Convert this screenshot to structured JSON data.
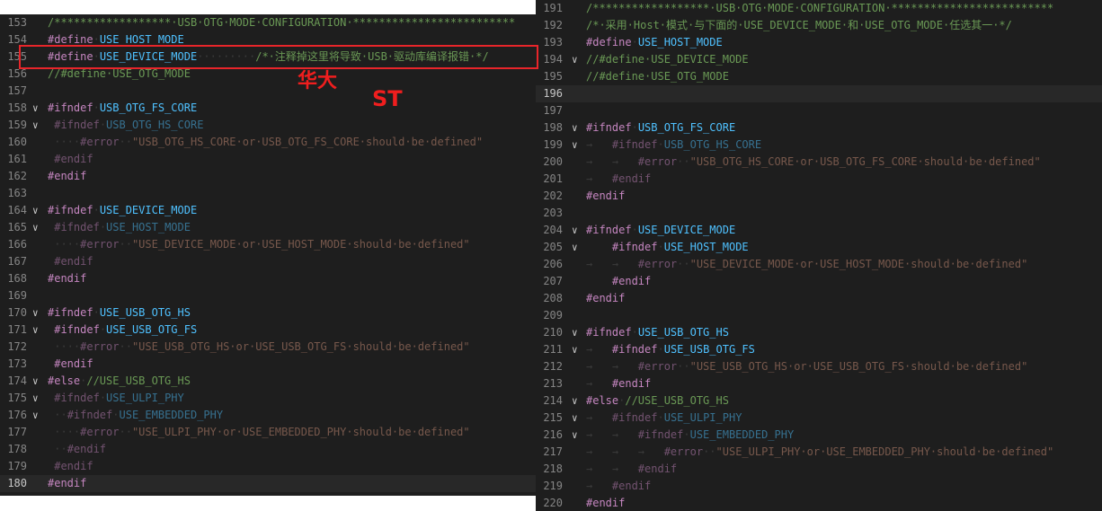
{
  "left_label": "华大",
  "right_label": "ST",
  "left": {
    "lines": [
      {
        "n": "153",
        "fold": "",
        "segs": [
          {
            "t": "/******************·USB·OTG·MODE·CONFIGURATION·*************************",
            "c": "cm"
          }
        ]
      },
      {
        "n": "154",
        "fold": "",
        "segs": [
          {
            "t": "#define",
            "c": "dir"
          },
          {
            "t": "·",
            "c": "ws"
          },
          {
            "t": "USE_HOST_MODE",
            "c": "mac"
          }
        ]
      },
      {
        "n": "155",
        "fold": "",
        "segs": [
          {
            "t": "#define",
            "c": "dir"
          },
          {
            "t": "·",
            "c": "ws"
          },
          {
            "t": "USE_DEVICE_MODE",
            "c": "mac"
          },
          {
            "t": "·········",
            "c": "ws"
          },
          {
            "t": "/*·注释掉这里将导致·USB·驱动库编译报错·*/",
            "c": "cm"
          }
        ]
      },
      {
        "n": "156",
        "fold": "",
        "segs": [
          {
            "t": "//#define·USE_OTG_MODE",
            "c": "cm"
          }
        ]
      },
      {
        "n": "157",
        "fold": "",
        "segs": []
      },
      {
        "n": "158",
        "fold": "v",
        "segs": [
          {
            "t": "#ifndef",
            "c": "dir"
          },
          {
            "t": "·",
            "c": "ws"
          },
          {
            "t": "USB_OTG_FS_CORE",
            "c": "mac"
          }
        ]
      },
      {
        "n": "159",
        "fold": "v",
        "segs": [
          {
            "t": " ",
            "c": "ws"
          },
          {
            "t": "#ifndef",
            "c": "dir dim"
          },
          {
            "t": "·",
            "c": "ws"
          },
          {
            "t": "USB_OTG_HS_CORE",
            "c": "mac dim"
          }
        ]
      },
      {
        "n": "160",
        "fold": "",
        "segs": [
          {
            "t": " ····",
            "c": "ws"
          },
          {
            "t": "#error",
            "c": "dir dim"
          },
          {
            "t": "··",
            "c": "ws"
          },
          {
            "t": "\"USB_OTG_HS_CORE·or·USB_OTG_FS_CORE·should·be·defined\"",
            "c": "str dim"
          }
        ]
      },
      {
        "n": "161",
        "fold": "",
        "segs": [
          {
            "t": " ",
            "c": "ws"
          },
          {
            "t": "#endif",
            "c": "dir dim"
          }
        ]
      },
      {
        "n": "162",
        "fold": "",
        "segs": [
          {
            "t": "#endif",
            "c": "dir"
          }
        ]
      },
      {
        "n": "163",
        "fold": "",
        "segs": []
      },
      {
        "n": "164",
        "fold": "v",
        "segs": [
          {
            "t": "#ifndef",
            "c": "dir"
          },
          {
            "t": "·",
            "c": "ws"
          },
          {
            "t": "USE_DEVICE_MODE",
            "c": "mac"
          }
        ]
      },
      {
        "n": "165",
        "fold": "v",
        "segs": [
          {
            "t": " ",
            "c": "ws"
          },
          {
            "t": "#ifndef",
            "c": "dir dim"
          },
          {
            "t": "·",
            "c": "ws"
          },
          {
            "t": "USE_HOST_MODE",
            "c": "mac dim"
          }
        ]
      },
      {
        "n": "166",
        "fold": "",
        "segs": [
          {
            "t": " ····",
            "c": "ws"
          },
          {
            "t": "#error",
            "c": "dir dim"
          },
          {
            "t": "··",
            "c": "ws"
          },
          {
            "t": "\"USE_DEVICE_MODE·or·USE_HOST_MODE·should·be·defined\"",
            "c": "str dim"
          }
        ]
      },
      {
        "n": "167",
        "fold": "",
        "segs": [
          {
            "t": " ",
            "c": "ws"
          },
          {
            "t": "#endif",
            "c": "dir dim"
          }
        ]
      },
      {
        "n": "168",
        "fold": "",
        "segs": [
          {
            "t": "#endif",
            "c": "dir"
          }
        ]
      },
      {
        "n": "169",
        "fold": "",
        "segs": []
      },
      {
        "n": "170",
        "fold": "v",
        "segs": [
          {
            "t": "#ifndef",
            "c": "dir"
          },
          {
            "t": "·",
            "c": "ws"
          },
          {
            "t": "USE_USB_OTG_HS",
            "c": "mac"
          }
        ]
      },
      {
        "n": "171",
        "fold": "v",
        "segs": [
          {
            "t": " ",
            "c": "ws"
          },
          {
            "t": "#ifndef",
            "c": "dir"
          },
          {
            "t": "·",
            "c": "ws"
          },
          {
            "t": "USE_USB_OTG_FS",
            "c": "mac"
          }
        ]
      },
      {
        "n": "172",
        "fold": "",
        "segs": [
          {
            "t": " ····",
            "c": "ws"
          },
          {
            "t": "#error",
            "c": "dir dim"
          },
          {
            "t": "··",
            "c": "ws"
          },
          {
            "t": "\"USE_USB_OTG_HS·or·USE_USB_OTG_FS·should·be·defined\"",
            "c": "str dim"
          }
        ]
      },
      {
        "n": "173",
        "fold": "",
        "segs": [
          {
            "t": " ",
            "c": "ws"
          },
          {
            "t": "#endif",
            "c": "dir"
          }
        ]
      },
      {
        "n": "174",
        "fold": "v",
        "segs": [
          {
            "t": "#else",
            "c": "dir"
          },
          {
            "t": "·",
            "c": "ws"
          },
          {
            "t": "//USE_USB_OTG_HS",
            "c": "cm"
          }
        ]
      },
      {
        "n": "175",
        "fold": "v",
        "segs": [
          {
            "t": " ",
            "c": "ws"
          },
          {
            "t": "#ifndef",
            "c": "dir dim"
          },
          {
            "t": "·",
            "c": "ws"
          },
          {
            "t": "USE_ULPI_PHY",
            "c": "mac dim"
          }
        ]
      },
      {
        "n": "176",
        "fold": "v",
        "segs": [
          {
            "t": " ··",
            "c": "ws"
          },
          {
            "t": "#ifndef",
            "c": "dir dim"
          },
          {
            "t": "·",
            "c": "ws"
          },
          {
            "t": "USE_EMBEDDED_PHY",
            "c": "mac dim"
          }
        ]
      },
      {
        "n": "177",
        "fold": "",
        "segs": [
          {
            "t": " ····",
            "c": "ws"
          },
          {
            "t": "#error",
            "c": "dir dim"
          },
          {
            "t": "··",
            "c": "ws"
          },
          {
            "t": "\"USE_ULPI_PHY·or·USE_EMBEDDED_PHY·should·be·defined\"",
            "c": "str dim"
          }
        ]
      },
      {
        "n": "178",
        "fold": "",
        "segs": [
          {
            "t": " ··",
            "c": "ws"
          },
          {
            "t": "#endif",
            "c": "dir dim"
          }
        ]
      },
      {
        "n": "179",
        "fold": "",
        "segs": [
          {
            "t": " ",
            "c": "ws"
          },
          {
            "t": "#endif",
            "c": "dir dim"
          }
        ]
      },
      {
        "n": "180",
        "fold": "",
        "active": true,
        "segs": [
          {
            "t": "#endif",
            "c": "dir"
          }
        ]
      }
    ]
  },
  "right": {
    "lines": [
      {
        "n": "191",
        "fold": "",
        "segs": [
          {
            "t": "/******************·USB·OTG·MODE·CONFIGURATION·*************************",
            "c": "cm"
          }
        ]
      },
      {
        "n": "192",
        "fold": "",
        "segs": [
          {
            "t": "/*·采用·Host·模式·与下面的·USE_DEVICE_MODE·和·USE_OTG_MODE·任选其一·*/",
            "c": "cm"
          }
        ]
      },
      {
        "n": "193",
        "fold": "",
        "segs": [
          {
            "t": "#define",
            "c": "dir"
          },
          {
            "t": "·",
            "c": "ws"
          },
          {
            "t": "USE_HOST_MODE",
            "c": "mac"
          }
        ]
      },
      {
        "n": "194",
        "fold": "v",
        "segs": [
          {
            "t": "//#define·USE_DEVICE_MODE",
            "c": "cm"
          }
        ]
      },
      {
        "n": "195",
        "fold": "",
        "segs": [
          {
            "t": "//#define·USE_OTG_MODE",
            "c": "cm"
          }
        ]
      },
      {
        "n": "196",
        "fold": "",
        "active": true,
        "segs": []
      },
      {
        "n": "197",
        "fold": "",
        "segs": []
      },
      {
        "n": "198",
        "fold": "v",
        "segs": [
          {
            "t": "#ifndef",
            "c": "dir"
          },
          {
            "t": "·",
            "c": "ws"
          },
          {
            "t": "USB_OTG_FS_CORE",
            "c": "mac"
          }
        ]
      },
      {
        "n": "199",
        "fold": "v",
        "segs": [
          {
            "t": "→   ",
            "c": "ws"
          },
          {
            "t": "#ifndef",
            "c": "dir dim"
          },
          {
            "t": "·",
            "c": "ws"
          },
          {
            "t": "USB_OTG_HS_CORE",
            "c": "mac dim"
          }
        ]
      },
      {
        "n": "200",
        "fold": "",
        "segs": [
          {
            "t": "→   →   ",
            "c": "ws"
          },
          {
            "t": "#error",
            "c": "dir dim"
          },
          {
            "t": "··",
            "c": "ws"
          },
          {
            "t": "\"USB_OTG_HS_CORE·or·USB_OTG_FS_CORE·should·be·defined\"",
            "c": "str dim"
          }
        ]
      },
      {
        "n": "201",
        "fold": "",
        "segs": [
          {
            "t": "→   ",
            "c": "ws"
          },
          {
            "t": "#endif",
            "c": "dir dim"
          }
        ]
      },
      {
        "n": "202",
        "fold": "",
        "segs": [
          {
            "t": "#endif",
            "c": "dir"
          }
        ]
      },
      {
        "n": "203",
        "fold": "",
        "segs": []
      },
      {
        "n": "204",
        "fold": "v",
        "segs": [
          {
            "t": "#ifndef",
            "c": "dir"
          },
          {
            "t": "·",
            "c": "ws"
          },
          {
            "t": "USE_DEVICE_MODE",
            "c": "mac"
          }
        ]
      },
      {
        "n": "205",
        "fold": "v",
        "segs": [
          {
            "t": "    ",
            "c": "ws"
          },
          {
            "t": "#ifndef",
            "c": "dir"
          },
          {
            "t": "·",
            "c": "ws"
          },
          {
            "t": "USE_HOST_MODE",
            "c": "mac"
          }
        ]
      },
      {
        "n": "206",
        "fold": "",
        "segs": [
          {
            "t": "→   →   ",
            "c": "ws"
          },
          {
            "t": "#error",
            "c": "dir dim"
          },
          {
            "t": "··",
            "c": "ws"
          },
          {
            "t": "\"USE_DEVICE_MODE·or·USE_HOST_MODE·should·be·defined\"",
            "c": "str dim"
          }
        ]
      },
      {
        "n": "207",
        "fold": "",
        "segs": [
          {
            "t": "    ",
            "c": "ws"
          },
          {
            "t": "#endif",
            "c": "dir"
          }
        ]
      },
      {
        "n": "208",
        "fold": "",
        "segs": [
          {
            "t": "#endif",
            "c": "dir"
          }
        ]
      },
      {
        "n": "209",
        "fold": "",
        "segs": []
      },
      {
        "n": "210",
        "fold": "v",
        "segs": [
          {
            "t": "#ifndef",
            "c": "dir"
          },
          {
            "t": "·",
            "c": "ws"
          },
          {
            "t": "USE_USB_OTG_HS",
            "c": "mac"
          }
        ]
      },
      {
        "n": "211",
        "fold": "v",
        "segs": [
          {
            "t": "→   ",
            "c": "ws"
          },
          {
            "t": "#ifndef",
            "c": "dir"
          },
          {
            "t": "·",
            "c": "ws"
          },
          {
            "t": "USE_USB_OTG_FS",
            "c": "mac"
          }
        ]
      },
      {
        "n": "212",
        "fold": "",
        "segs": [
          {
            "t": "→   →   ",
            "c": "ws"
          },
          {
            "t": "#error",
            "c": "dir dim"
          },
          {
            "t": "··",
            "c": "ws"
          },
          {
            "t": "\"USE_USB_OTG_HS·or·USE_USB_OTG_FS·should·be·defined\"",
            "c": "str dim"
          }
        ]
      },
      {
        "n": "213",
        "fold": "",
        "segs": [
          {
            "t": "→   ",
            "c": "ws"
          },
          {
            "t": "#endif",
            "c": "dir"
          }
        ]
      },
      {
        "n": "214",
        "fold": "v",
        "segs": [
          {
            "t": "#else",
            "c": "dir"
          },
          {
            "t": "·",
            "c": "ws"
          },
          {
            "t": "//USE_USB_OTG_HS",
            "c": "cm"
          }
        ]
      },
      {
        "n": "215",
        "fold": "v",
        "segs": [
          {
            "t": "→   ",
            "c": "ws"
          },
          {
            "t": "#ifndef",
            "c": "dir dim"
          },
          {
            "t": "·",
            "c": "ws"
          },
          {
            "t": "USE_ULPI_PHY",
            "c": "mac dim"
          }
        ]
      },
      {
        "n": "216",
        "fold": "v",
        "segs": [
          {
            "t": "→   →   ",
            "c": "ws"
          },
          {
            "t": "#ifndef",
            "c": "dir dim"
          },
          {
            "t": "·",
            "c": "ws"
          },
          {
            "t": "USE_EMBEDDED_PHY",
            "c": "mac dim"
          }
        ]
      },
      {
        "n": "217",
        "fold": "",
        "segs": [
          {
            "t": "→   →   →   ",
            "c": "ws"
          },
          {
            "t": "#error",
            "c": "dir dim"
          },
          {
            "t": "··",
            "c": "ws"
          },
          {
            "t": "\"USE_ULPI_PHY·or·USE_EMBEDDED_PHY·should·be·defined\"",
            "c": "str dim"
          }
        ]
      },
      {
        "n": "218",
        "fold": "",
        "segs": [
          {
            "t": "→   →   ",
            "c": "ws"
          },
          {
            "t": "#endif",
            "c": "dir dim"
          }
        ]
      },
      {
        "n": "219",
        "fold": "",
        "segs": [
          {
            "t": "→   ",
            "c": "ws"
          },
          {
            "t": "#endif",
            "c": "dir dim"
          }
        ]
      },
      {
        "n": "220",
        "fold": "",
        "segs": [
          {
            "t": "#endif",
            "c": "dir"
          }
        ]
      }
    ]
  }
}
